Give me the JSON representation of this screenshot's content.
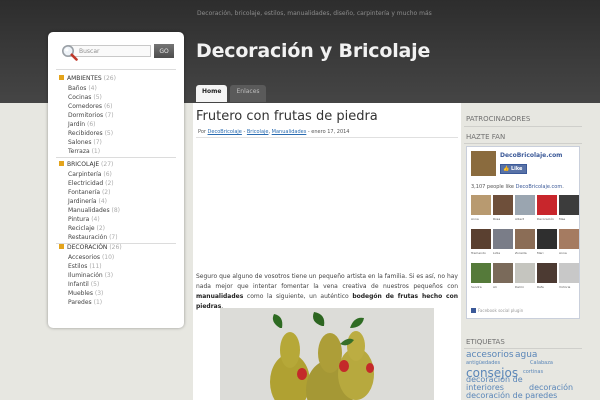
{
  "header": {
    "tagline": "Decoración, bricolaje, estilos, manualidades, diseño, carpintería y mucho más",
    "site_title": "Decoración y Bricolaje",
    "tabs": [
      {
        "label": "Home",
        "active": true
      },
      {
        "label": "Enlaces",
        "active": false
      }
    ]
  },
  "sidebar": {
    "search": {
      "placeholder": "Buscar",
      "button": "GO"
    },
    "categories": [
      {
        "name": "AMBIENTES",
        "count": "(26)",
        "items": [
          {
            "name": "Baños",
            "count": "(4)"
          },
          {
            "name": "Cocinas",
            "count": "(5)"
          },
          {
            "name": "Comedores",
            "count": "(6)"
          },
          {
            "name": "Dormitorios",
            "count": "(7)"
          },
          {
            "name": "Jardín",
            "count": "(6)"
          },
          {
            "name": "Recibidores",
            "count": "(5)"
          },
          {
            "name": "Salones",
            "count": "(7)"
          },
          {
            "name": "Terraza",
            "count": "(1)"
          }
        ]
      },
      {
        "name": "BRICOLAJE",
        "count": "(27)",
        "items": [
          {
            "name": "Carpintería",
            "count": "(6)"
          },
          {
            "name": "Electricidad",
            "count": "(2)"
          },
          {
            "name": "Fontanería",
            "count": "(2)"
          },
          {
            "name": "Jardinería",
            "count": "(4)"
          },
          {
            "name": "Manualidades",
            "count": "(8)"
          },
          {
            "name": "Pintura",
            "count": "(4)"
          },
          {
            "name": "Reciclaje",
            "count": "(2)"
          },
          {
            "name": "Restauración",
            "count": "(7)"
          }
        ]
      },
      {
        "name": "DECORACIÓN",
        "count": "(26)",
        "items": [
          {
            "name": "Accesorios",
            "count": "(10)"
          },
          {
            "name": "Estilos",
            "count": "(11)"
          },
          {
            "name": "Iluminación",
            "count": "(3)"
          },
          {
            "name": "Infantil",
            "count": "(5)"
          },
          {
            "name": "Muebles",
            "count": "(3)"
          },
          {
            "name": "Paredes",
            "count": "(1)"
          }
        ]
      }
    ]
  },
  "post": {
    "title": "Frutero con frutas de piedra",
    "meta_prefix": "Por",
    "author": "DecoBricolaje",
    "sep1": " - ",
    "cat1": "Bricolaje",
    "comma": ", ",
    "cat2": "Manualidades",
    "date": " - enero 17, 2014",
    "body_1": "Seguro que alguno de vosotros tiene un pequeño artista en la familia. Si es así, no hay nada mejor que intentar fomentar la vena creativa de nuestros pequeños con ",
    "body_bold_1": "manualidades",
    "body_2": " como la siguiente, un auténtico ",
    "body_bold_2": "bodegón de frutas hecho con piedras",
    "body_3": "."
  },
  "right": {
    "sponsors_title": "PATROCINADORES",
    "fan_title": "HAZTE FAN",
    "fb": {
      "page_name": "DecoBricolaje.com",
      "like_label": "Like",
      "count_text": "3,107 people like ",
      "count_link": "DecoBricolaje.com",
      "count_end": ".",
      "faces": [
        {
          "name": "Anna",
          "color": "#b89a70"
        },
        {
          "name": "Rosa",
          "color": "#6e4f3a"
        },
        {
          "name": "Albert",
          "color": "#9aa5b0"
        },
        {
          "name": "Decoración",
          "color": "#c8262c"
        },
        {
          "name": "Mae",
          "color": "#3c3c3c"
        },
        {
          "name": "Tremendo",
          "color": "#5a4030"
        },
        {
          "name": "Lidia",
          "color": "#7a7d88"
        },
        {
          "name": "Zoraida",
          "color": "#8b6d56"
        },
        {
          "name": "Mari",
          "color": "#2f2f2f"
        },
        {
          "name": "Anna",
          "color": "#a57b61"
        },
        {
          "name": "Sandra",
          "color": "#557a3a"
        },
        {
          "name": "Ali",
          "color": "#7a6a5a"
        },
        {
          "name": "Delmi",
          "color": "#c5c5bf"
        },
        {
          "name": "Rafa",
          "color": "#4c3a32"
        },
        {
          "name": "Victoria",
          "color": "#c8c8c8"
        }
      ],
      "plugin_text": "Facebook social plugin"
    },
    "tags_title": "ETIQUETAS",
    "tags": [
      {
        "label": "accesorios"
      },
      {
        "label": "agua"
      },
      {
        "label": "antigüedades"
      },
      {
        "label": "Calabaza"
      },
      {
        "label": "consejos"
      },
      {
        "label": "cortinas"
      },
      {
        "label": "decoración de interiores"
      },
      {
        "label": "decoración de paredes"
      },
      {
        "label": "decoración"
      }
    ]
  }
}
